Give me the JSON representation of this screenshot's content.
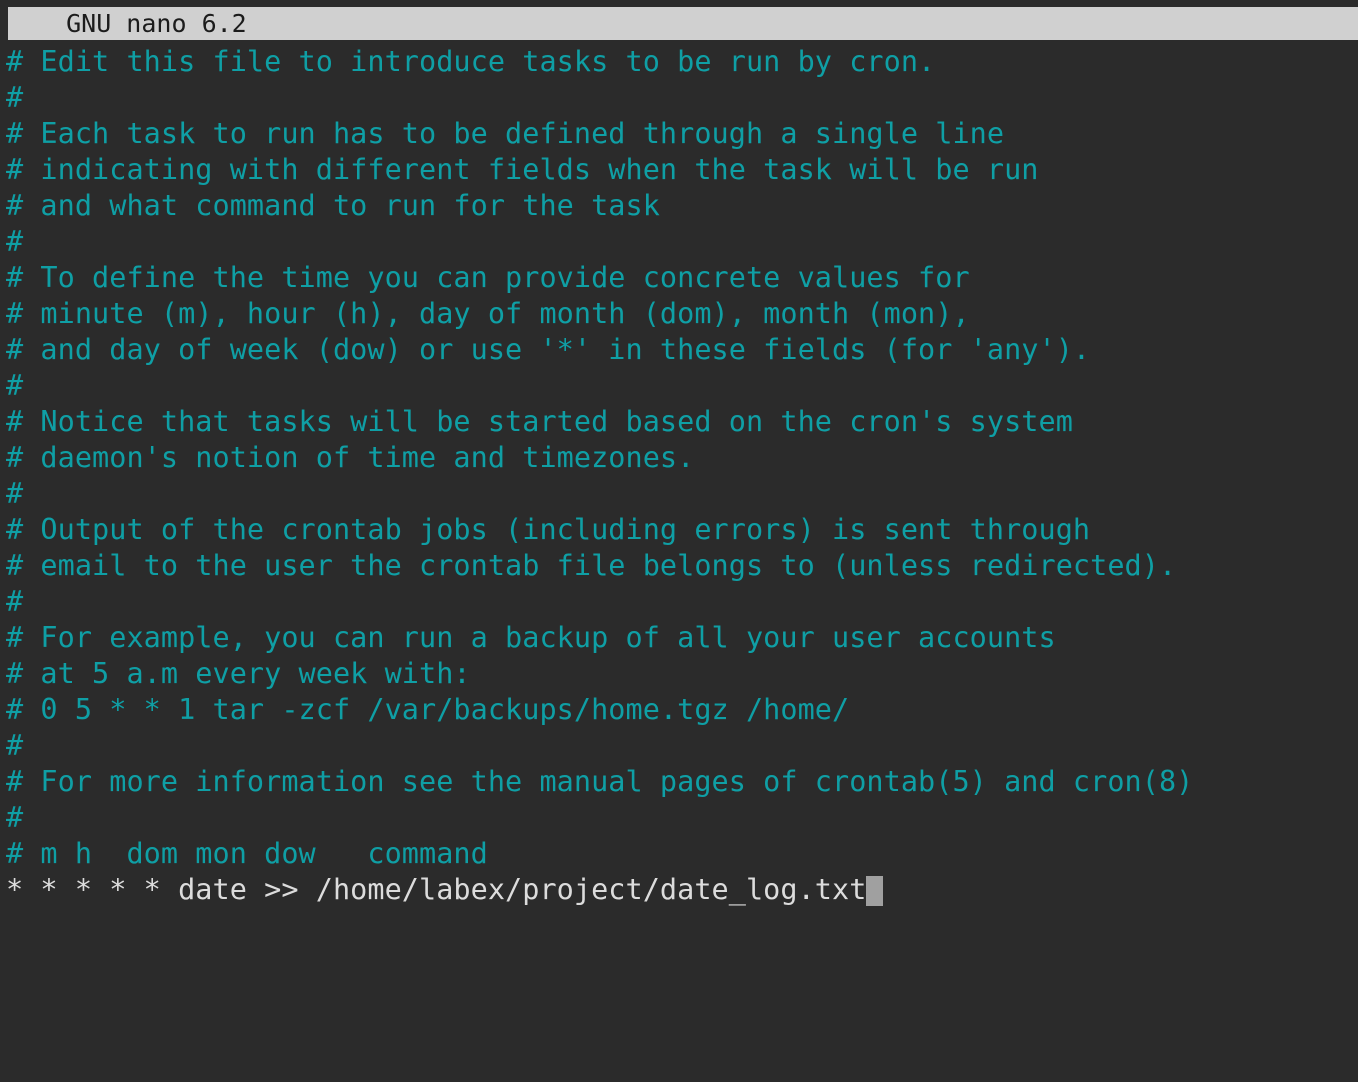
{
  "app": {
    "name": "GNU nano",
    "version": "6.2",
    "title": "  GNU nano 6.2"
  },
  "colors": {
    "background": "#2b2b2b",
    "comment_text": "#0f9fa5",
    "active_text": "#dcdcdc",
    "titlebar_background": "#d0d0d0",
    "titlebar_text": "#1c1c1c",
    "cursor": "#a0a0a0"
  },
  "editor": {
    "file_type": "crontab",
    "lines": [
      {
        "text": "# Edit this file to introduce tasks to be run by cron.",
        "kind": "comment"
      },
      {
        "text": "#",
        "kind": "comment"
      },
      {
        "text": "# Each task to run has to be defined through a single line",
        "kind": "comment"
      },
      {
        "text": "# indicating with different fields when the task will be run",
        "kind": "comment"
      },
      {
        "text": "# and what command to run for the task",
        "kind": "comment"
      },
      {
        "text": "#",
        "kind": "comment"
      },
      {
        "text": "# To define the time you can provide concrete values for",
        "kind": "comment"
      },
      {
        "text": "# minute (m), hour (h), day of month (dom), month (mon),",
        "kind": "comment"
      },
      {
        "text": "# and day of week (dow) or use '*' in these fields (for 'any').",
        "kind": "comment"
      },
      {
        "text": "#",
        "kind": "comment"
      },
      {
        "text": "# Notice that tasks will be started based on the cron's system",
        "kind": "comment"
      },
      {
        "text": "# daemon's notion of time and timezones.",
        "kind": "comment"
      },
      {
        "text": "#",
        "kind": "comment"
      },
      {
        "text": "# Output of the crontab jobs (including errors) is sent through",
        "kind": "comment"
      },
      {
        "text": "# email to the user the crontab file belongs to (unless redirected).",
        "kind": "comment"
      },
      {
        "text": "#",
        "kind": "comment"
      },
      {
        "text": "# For example, you can run a backup of all your user accounts",
        "kind": "comment"
      },
      {
        "text": "# at 5 a.m every week with:",
        "kind": "comment"
      },
      {
        "text": "# 0 5 * * 1 tar -zcf /var/backups/home.tgz /home/",
        "kind": "comment"
      },
      {
        "text": "#",
        "kind": "comment"
      },
      {
        "text": "# For more information see the manual pages of crontab(5) and cron(8)",
        "kind": "comment"
      },
      {
        "text": "#",
        "kind": "comment"
      },
      {
        "text": "# m h  dom mon dow   command",
        "kind": "comment"
      },
      {
        "text": "* * * * * date >> /home/labex/project/date_log.txt",
        "kind": "active",
        "cursor_at_end": true
      }
    ],
    "cursor": {
      "line_index": 23,
      "column": 49,
      "shape": "block"
    }
  }
}
